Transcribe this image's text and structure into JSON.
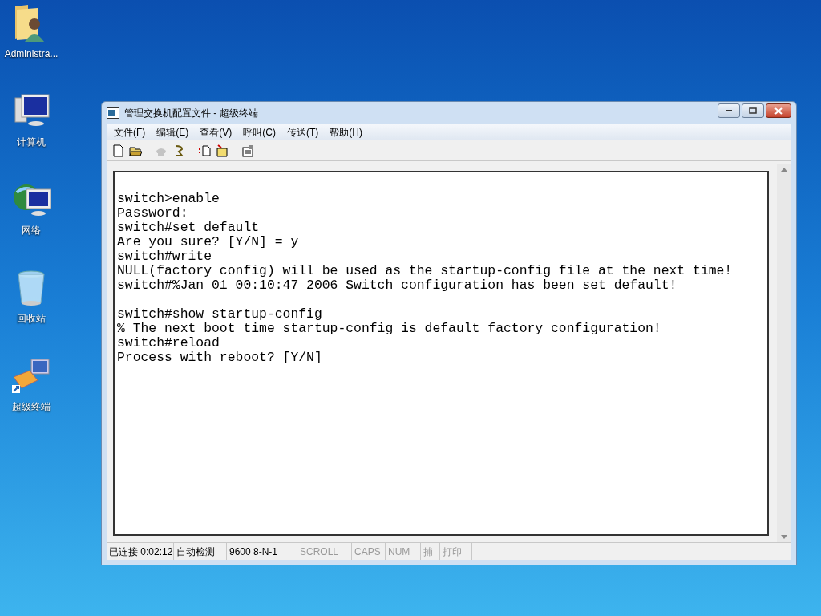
{
  "desktop_icons": [
    {
      "kind": "user-folder",
      "label": "Administra..."
    },
    {
      "kind": "computer",
      "label": "计算机"
    },
    {
      "kind": "network",
      "label": "网络"
    },
    {
      "kind": "recycle-bin",
      "label": "回收站"
    },
    {
      "kind": "terminal-shortcut",
      "label": "超级终端"
    }
  ],
  "window": {
    "title": "管理交换机配置文件 - 超级终端",
    "menu": [
      "文件(F)",
      "编辑(E)",
      "查看(V)",
      "呼叫(C)",
      "传送(T)",
      "帮助(H)"
    ],
    "toolbar": [
      {
        "kind": "new",
        "disabled": false
      },
      {
        "kind": "open",
        "disabled": false
      },
      {
        "kind": "call",
        "disabled": true
      },
      {
        "kind": "hangup",
        "disabled": false
      },
      {
        "kind": "send",
        "disabled": false
      },
      {
        "kind": "receive",
        "disabled": false
      },
      {
        "kind": "properties",
        "disabled": false
      }
    ],
    "terminal_blocks": [
      [
        "switch>enable",
        "Password:",
        "switch#set default",
        "Are you sure? [Y/N] = y",
        "switch#write",
        "NULL(factory config) will be used as the startup-config file at the next time!",
        "switch#%Jan 01 00:10:47 2006 Switch configuration has been set default!"
      ],
      [
        "switch#show startup-config",
        "% The next boot time startup-config is default factory configuration!",
        "switch#reload",
        "Process with reboot? [Y/N]"
      ]
    ],
    "status_bar": [
      {
        "text": "已连接 0:02:12",
        "disabled": false
      },
      {
        "text": "自动检测",
        "disabled": false
      },
      {
        "text": "9600 8-N-1",
        "disabled": false
      },
      {
        "text": "SCROLL",
        "disabled": true
      },
      {
        "text": "CAPS",
        "disabled": true
      },
      {
        "text": "NUM",
        "disabled": true
      },
      {
        "text": "捕",
        "disabled": true
      },
      {
        "text": "打印",
        "disabled": true
      }
    ]
  }
}
